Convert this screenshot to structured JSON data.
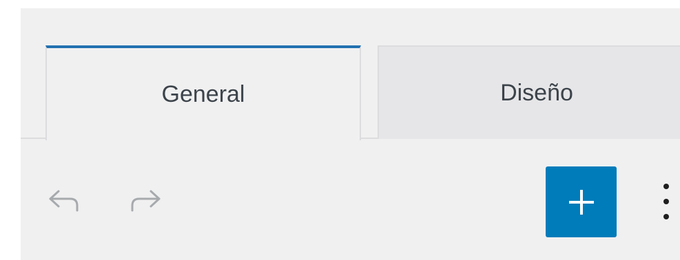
{
  "tabs": [
    {
      "label": "General",
      "active": true
    },
    {
      "label": "Diseño",
      "active": false
    }
  ],
  "toolbar": {
    "undo_icon": "undo-arrow-icon",
    "redo_icon": "redo-arrow-icon",
    "add_icon": "plus-icon",
    "more_icon": "vertical-ellipsis-icon"
  },
  "colors": {
    "accent": "#2271b1",
    "add_button": "#007cba",
    "panel_background": "#f0f0f1",
    "inactive_tab": "#e6e6e8",
    "text": "#3c434a",
    "icon_muted": "#a7aaad"
  }
}
